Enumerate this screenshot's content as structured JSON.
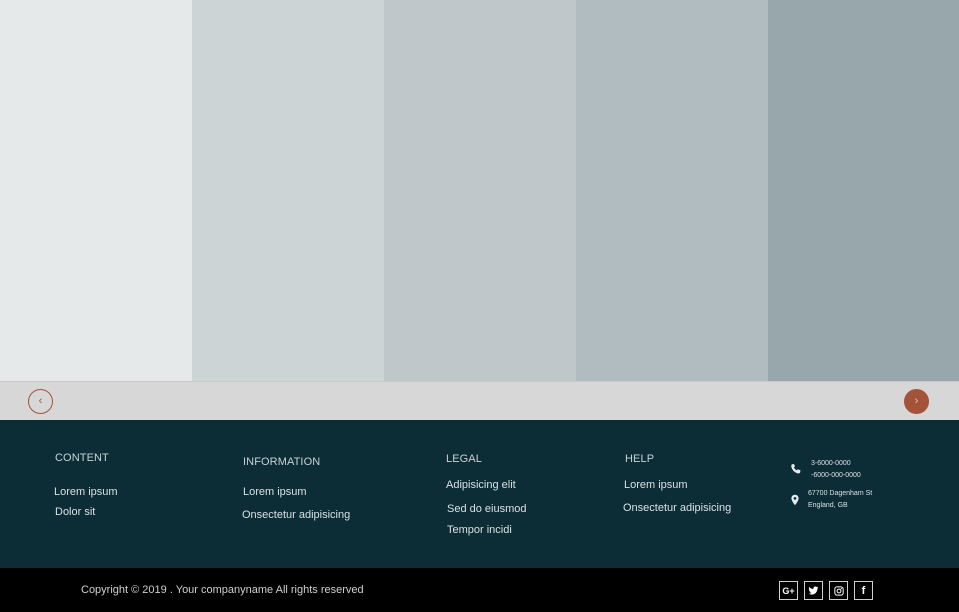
{
  "slider": {
    "panel_colors": [
      "#e6e9ea",
      "#cdd4d5",
      "#bfc7ca",
      "#b1bcc1",
      "#98a7ab"
    ],
    "prev_icon": "chevron-left-icon",
    "next_icon": "chevron-right-icon",
    "prev_glyph": "‹",
    "next_glyph": "›",
    "accent_color": "#a4533b"
  },
  "footer": {
    "columns": [
      {
        "title": "CONTENT",
        "links": [
          "Lorem ipsum",
          "Dolor sit"
        ]
      },
      {
        "title": "INFORMATION",
        "links": [
          "Lorem ipsum",
          "Onsectetur adipisicing"
        ]
      },
      {
        "title": "LEGAL",
        "links": [
          "Adipisicing elit",
          "Sed do eiusmod",
          "Tempor incidi"
        ]
      },
      {
        "title": "HELP",
        "links": [
          "Lorem ipsum",
          "Onsectetur adipisicing"
        ]
      }
    ],
    "contact": {
      "phone_icon": "phone-icon",
      "phone_lines": [
        "3-6000-0000",
        "-6000-000-0000"
      ],
      "location_icon": "map-pin-icon",
      "address_lines": [
        "67700 Dagenham St",
        "England, GB"
      ]
    },
    "background_color": "#0c2c36"
  },
  "bottom_bar": {
    "copyright": "Copyright © 2019 . Your companyname  All rights reserved",
    "social": [
      {
        "icon": "google-plus-icon",
        "glyph": "G+"
      },
      {
        "icon": "twitter-icon",
        "glyph": ""
      },
      {
        "icon": "instagram-icon",
        "glyph": ""
      },
      {
        "icon": "facebook-icon",
        "glyph": "f"
      }
    ]
  }
}
